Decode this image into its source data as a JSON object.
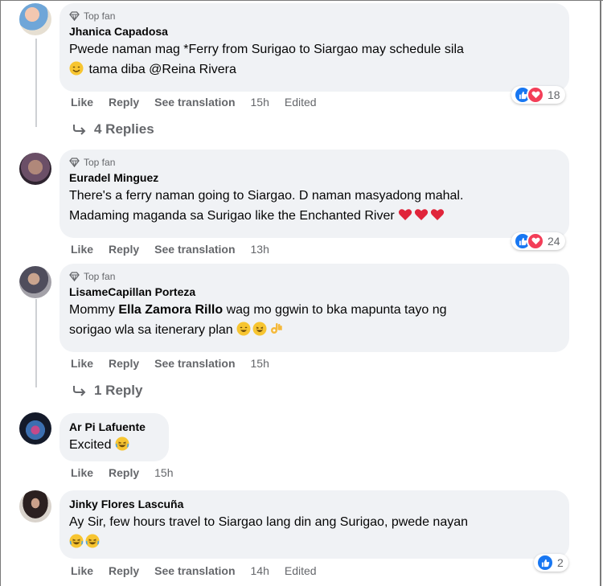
{
  "comments": [
    {
      "badge": "Top fan",
      "name": "Jhanica Capadosa",
      "line1": "Pwede naman mag *Ferry from Surigao to Siargao may schedule sila",
      "line2": "tama diba @Reina Rivera",
      "like": "Like",
      "reply": "Reply",
      "translate": "See translation",
      "time": "15h",
      "edited": "Edited",
      "reaction_count": "18",
      "replies": "4 Replies"
    },
    {
      "badge": "Top fan",
      "name": "Euradel Minguez",
      "line1": "There's a ferry naman going to Siargao. D naman masyadong mahal.",
      "line2": "Madaming maganda sa Surigao like the Enchanted River",
      "like": "Like",
      "reply": "Reply",
      "translate": "See translation",
      "time": "13h",
      "reaction_count": "24"
    },
    {
      "badge": "Top fan",
      "name": "LisameCapillan Porteza",
      "line1_prefix": "Mommy ",
      "line1_bold": "Ella Zamora Rillo",
      "line1_suffix": " wag mo ggwin to bka mapunta tayo ng",
      "line2": "sorigao wla sa itenerary plan",
      "like": "Like",
      "reply": "Reply",
      "translate": "See translation",
      "time": "15h",
      "replies": "1 Reply"
    },
    {
      "name": "Ar Pi Lafuente",
      "line1": "Excited",
      "like": "Like",
      "reply": "Reply",
      "time": "15h"
    },
    {
      "name": "Jinky Flores Lascuña",
      "line1": "Ay Sir, few hours travel to Siargao lang din ang Surigao, pwede nayan",
      "like": "Like",
      "reply": "Reply",
      "translate": "See translation",
      "time": "14h",
      "edited": "Edited",
      "reaction_count": "2"
    }
  ],
  "colors": {
    "like": "#1877f2",
    "love": "#f33e58",
    "bubble": "#f0f2f5",
    "meta": "#65676b"
  }
}
